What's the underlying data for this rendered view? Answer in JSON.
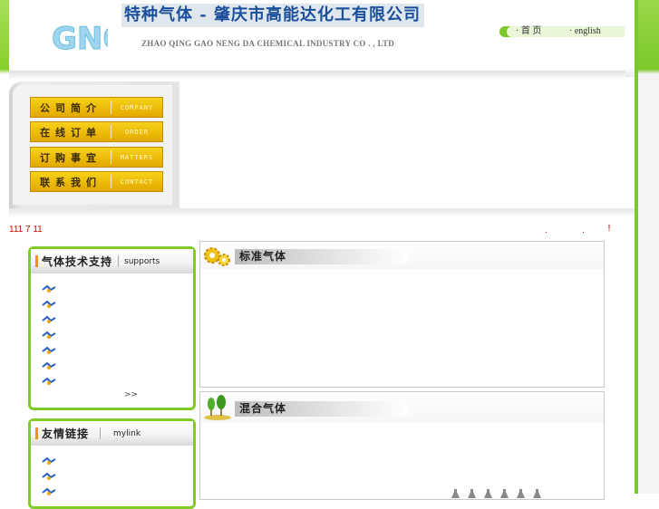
{
  "header": {
    "logo_text": "GNO",
    "company_cn": "特种气体 - 肇庆市高能达化工有限公司",
    "company_en": "ZHAO QING GAO NENG DA CHEMICAL INDUSTRY CO . , LTD",
    "nav": {
      "home": "· 首  页",
      "english": "· english"
    }
  },
  "menu": {
    "items": [
      {
        "cn": "公司简介",
        "en": "COMPANY"
      },
      {
        "cn": "在线订单",
        "en": "ORDER"
      },
      {
        "cn": "订购事宜",
        "en": "MATTERS"
      },
      {
        "cn": "联系我们",
        "en": "CONTACT"
      }
    ]
  },
  "scroll": {
    "text": "111 7 11",
    "dot1": ".",
    "dot2": ".",
    "bang": "!"
  },
  "support_box": {
    "title_cn": "气体技术支持",
    "title_en": "supports",
    "item_count": 7,
    "more": ">>"
  },
  "link_box": {
    "title_cn": "友情链接",
    "title_en": "mylink",
    "item_count": 3
  },
  "sections": {
    "standard_gas": "标准气体",
    "mixed_gas": "混合气体"
  },
  "colors": {
    "brand_green": "#7fcb2c",
    "menu_yellow": "#f2c200",
    "title_blue": "#1b4f9c",
    "scroll_red": "#d40000"
  }
}
